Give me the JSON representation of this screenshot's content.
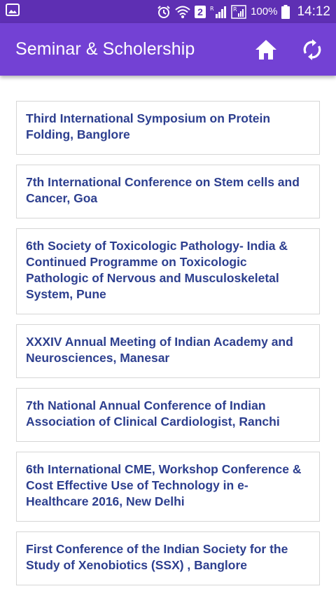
{
  "status_bar": {
    "sim_slot": "2",
    "battery": "100%",
    "time": "14:12",
    "icons": [
      "gallery-icon",
      "alarm-icon",
      "wifi-icon",
      "sim-2-icon",
      "roaming-signal-icon",
      "signal-icon",
      "battery-icon"
    ]
  },
  "app_bar": {
    "title": "Seminar & Scholership",
    "actions": [
      "home-icon",
      "refresh-icon"
    ]
  },
  "items": [
    {
      "title": "Third International Symposium on Protein Folding, Banglore"
    },
    {
      "title": "7th International Conference on Stem cells and Cancer, Goa"
    },
    {
      "title": "6th Society of Toxicologic Pathology- India & Continued Programme on Toxicologic Pathologic of Nervous and Musculoskeletal System, Pune"
    },
    {
      "title": "XXXIV Annual Meeting of Indian Academy and Neurosciences, Manesar"
    },
    {
      "title": "7th National Annual Conference of Indian Association of Clinical Cardiologist, Ranchi"
    },
    {
      "title": "6th International CME, Workshop Conference & Cost Effective Use of Technology in e-Healthcare 2016, New Delhi"
    },
    {
      "title": "First Conference of the Indian Society for the Study of Xenobiotics (SSX) , Banglore"
    }
  ],
  "colors": {
    "status_bar": "#5e2fb3",
    "app_bar": "#7341d4",
    "item_text": "#2d3f8f",
    "card_border": "#d6d6d6"
  }
}
